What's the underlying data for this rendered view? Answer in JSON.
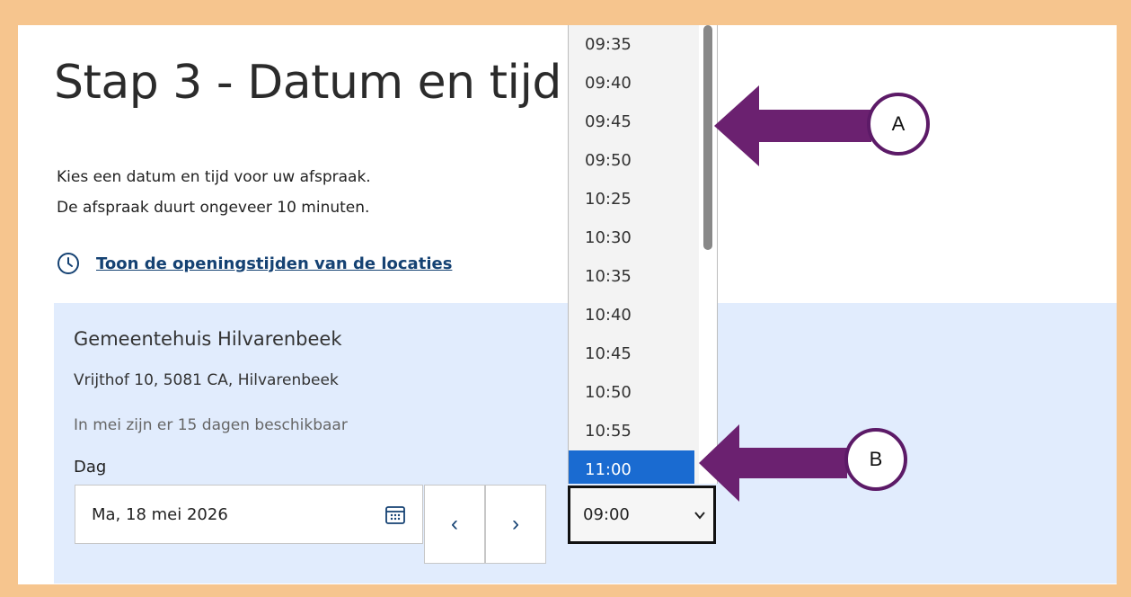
{
  "page": {
    "title": "Stap 3 - Datum en tijd",
    "intro": [
      "Kies een datum en tijd voor uw afspraak.",
      "De afspraak duurt ongeveer 10 minuten."
    ],
    "hours_link": "Toon de openingstijden van de locaties"
  },
  "location": {
    "name": "Gemeentehuis Hilvarenbeek",
    "address": "Vrijthof 10, 5081 CA, Hilvarenbeek",
    "availability": "In mei zijn er 15 dagen beschikbaar",
    "day_label": "Dag",
    "date_value": "Ma, 18 mei 2026",
    "prev_label": "‹",
    "next_label": "›"
  },
  "time_select": {
    "value": "09:00",
    "options": [
      "09:35",
      "09:40",
      "09:45",
      "09:50",
      "10:25",
      "10:30",
      "10:35",
      "10:40",
      "10:45",
      "10:50",
      "10:55",
      "11:00"
    ],
    "highlighted": "11:00"
  },
  "annotations": {
    "a_label": "A",
    "b_label": "B",
    "arrow_color": "#5c1a67"
  },
  "colors": {
    "frame": "#f6c58e",
    "panel": "#e1ecfd",
    "link": "#154273",
    "selected": "#1a6bd1"
  }
}
